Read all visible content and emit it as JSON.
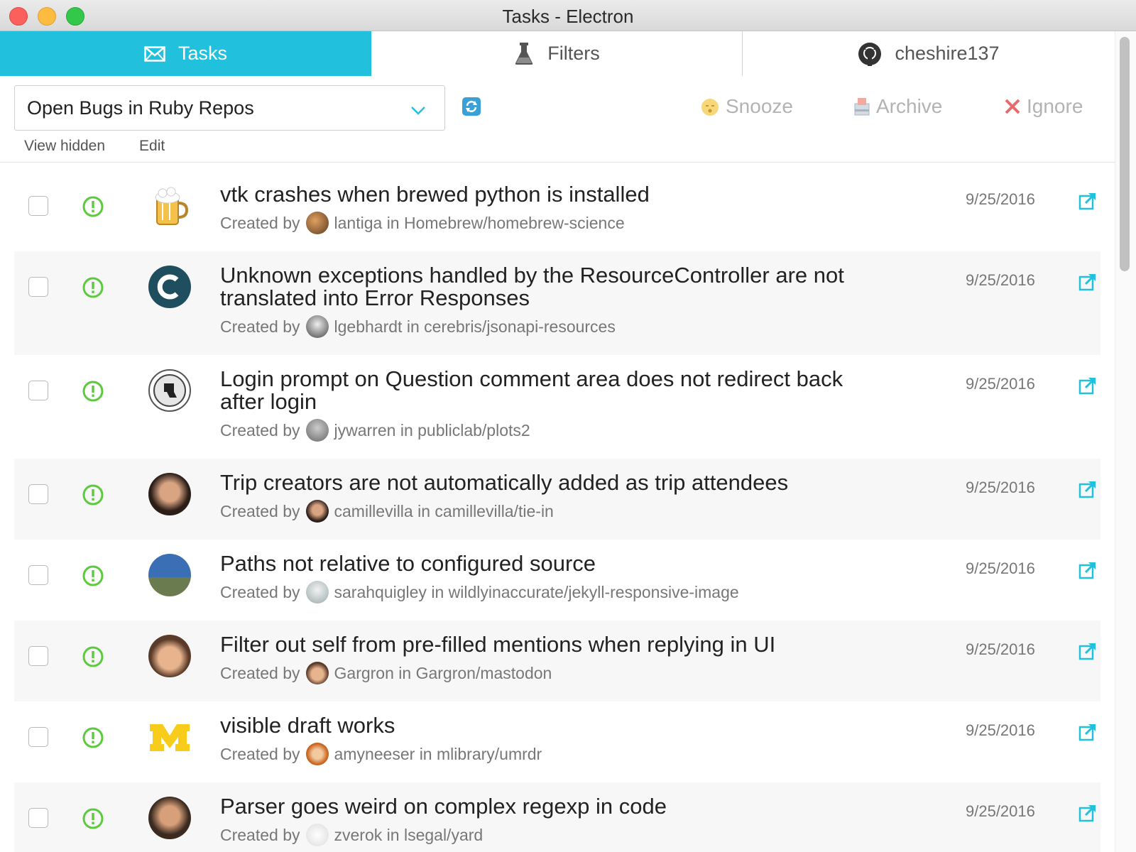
{
  "window": {
    "title": "Tasks - Electron"
  },
  "tabs": [
    {
      "label": "Tasks",
      "icon": "envelope-icon",
      "active": true
    },
    {
      "label": "Filters",
      "icon": "flask-icon",
      "active": false
    },
    {
      "label": "cheshire137",
      "icon": "github-icon",
      "active": false
    }
  ],
  "toolbar": {
    "filter_value": "Open Bugs in Ruby Repos",
    "view_hidden": "View hidden",
    "edit": "Edit",
    "snooze": "Snooze",
    "archive": "Archive",
    "ignore": "Ignore"
  },
  "colors": {
    "accent": "#21c1dd",
    "status_open": "#5cc93f",
    "ignore_x": "#e86a6a"
  },
  "created_by_label": "Created by",
  "in_label": "in",
  "tasks": [
    {
      "title": "vtk crashes when brewed python is installed",
      "user": "lantiga",
      "repo": "Homebrew/homebrew-science",
      "date": "9/25/2016",
      "repo_avatar": "homebrew-beer-icon"
    },
    {
      "title": "Unknown exceptions handled by the ResourceController are not translated into Error Responses",
      "user": "lgebhardt",
      "repo": "cerebris/jsonapi-resources",
      "date": "9/25/2016",
      "repo_avatar": "cerebris-c-logo"
    },
    {
      "title": "Login prompt on Question comment area does not redirect back after login",
      "user": "jywarren",
      "repo": "publiclab/plots2",
      "date": "9/25/2016",
      "repo_avatar": "publiclab-logo"
    },
    {
      "title": "Trip creators are not automatically added as trip attendees",
      "user": "camillevilla",
      "repo": "camillevilla/tie-in",
      "date": "9/25/2016",
      "repo_avatar": "person-avatar"
    },
    {
      "title": "Paths not relative to configured source",
      "user": "sarahquigley",
      "repo": "wildlyinaccurate/jekyll-responsive-image",
      "date": "9/25/2016",
      "repo_avatar": "person-avatar"
    },
    {
      "title": "Filter out self from pre-filled mentions when replying in UI",
      "user": "Gargron",
      "repo": "Gargron/mastodon",
      "date": "9/25/2016",
      "repo_avatar": "cartoon-avatar"
    },
    {
      "title": "visible draft works",
      "user": "amyneeser",
      "repo": "mlibrary/umrdr",
      "date": "9/25/2016",
      "repo_avatar": "michigan-m-logo"
    },
    {
      "title": "Parser goes weird on complex regexp in code",
      "user": "zverok",
      "repo": "lsegal/yard",
      "date": "9/25/2016",
      "repo_avatar": "person-avatar"
    }
  ]
}
